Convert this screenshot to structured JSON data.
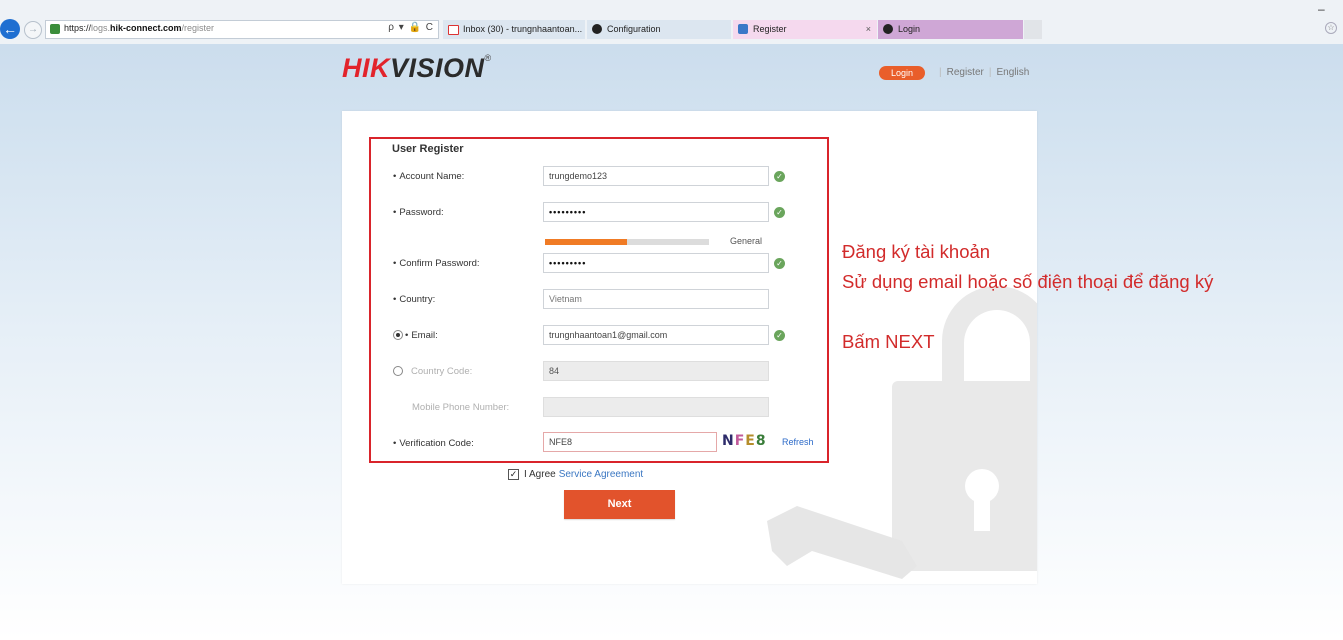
{
  "browser": {
    "window_controls": "–",
    "address_scheme": "https://",
    "address_sub": "logs.",
    "address_domain": "hik-connect.com",
    "address_path": "/register",
    "address_tools": "ρ ▾ 🔒 C",
    "back_glyph": "←",
    "tabs": [
      {
        "label": "Inbox (30) - trungnhaantoan...",
        "icon": "gmail-icon"
      },
      {
        "label": "Configuration",
        "icon": "globe-icon"
      },
      {
        "label": "Register",
        "icon": "ie-page-icon",
        "close": "×"
      },
      {
        "label": "Login",
        "icon": "globe-icon"
      }
    ]
  },
  "header": {
    "logo_hik": "HIK",
    "logo_vision": "VISION",
    "logo_reg": "®",
    "login_label": "Login",
    "register_label": "Register",
    "language_label": "English",
    "separator": "|"
  },
  "form": {
    "title": "User Register",
    "required_marker": "•",
    "account_name_label": "Account Name:",
    "account_name_value": "trungdemo123",
    "password_label": "Password:",
    "password_value": "•••••••••",
    "strength_label": "General",
    "strength_fraction": 0.5,
    "confirm_password_label": "Confirm Password:",
    "confirm_password_value": "•••••••••",
    "country_label": "Country:",
    "country_value": "Vietnam",
    "email_label": "Email:",
    "email_value": "trungnhaantoan1@gmail.com",
    "country_code_label": "Country Code:",
    "country_code_value": "84",
    "mobile_label": "Mobile Phone Number:",
    "mobile_value": "",
    "verification_label": "Verification Code:",
    "verification_value": "NFE8",
    "captcha_chars": [
      "N",
      "F",
      "E",
      "8"
    ],
    "refresh_label": "Refresh",
    "valid_glyph": "✓",
    "agree_check": "✓",
    "agree_label": "I Agree",
    "service_agreement_label": "Service Agreement",
    "next_label": "Next"
  },
  "annotation": {
    "line1": "Đăng ký tài khoản",
    "line2": "Sử dụng email hoặc số điện thoại để đăng ký",
    "line3": "Bấm NEXT"
  },
  "colors": {
    "brand_red": "#e2232b",
    "button_orange": "#e2532c",
    "strength_orange": "#f07b25",
    "valid_green": "#6aa55c",
    "annotation_red": "#d22b2b"
  }
}
